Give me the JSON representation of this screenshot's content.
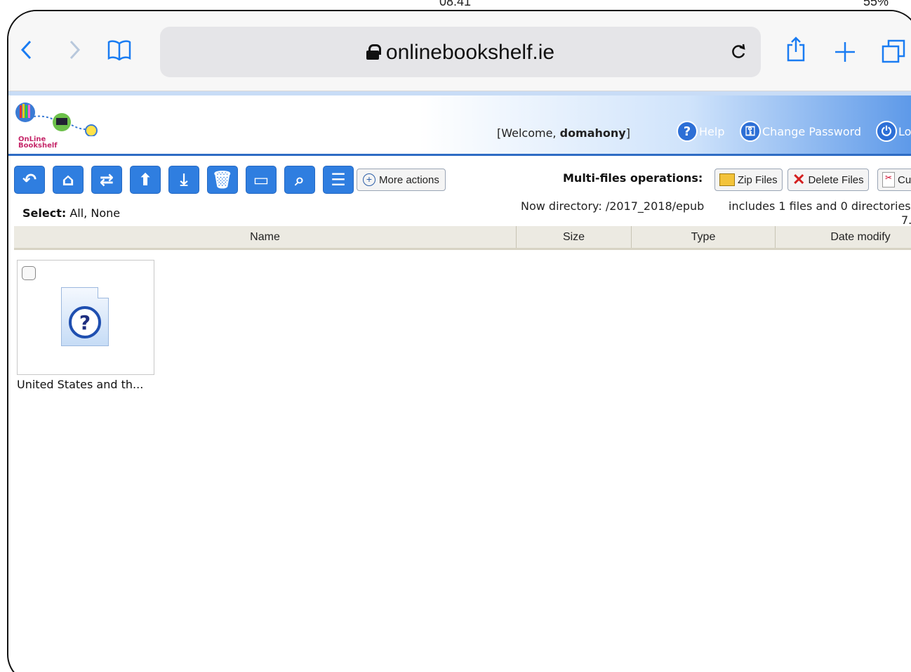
{
  "status": {
    "time": "08:41",
    "battery": "55%"
  },
  "browser": {
    "url": "onlinebookshelf.ie",
    "icons": [
      "back-icon",
      "forward-icon",
      "bookmarks-icon",
      "reload-icon",
      "share-icon",
      "new-tab-icon",
      "tabs-icon"
    ]
  },
  "header": {
    "logo_text_1": "OnLine",
    "logo_text_2": "Bookshelf",
    "welcome_prefix": "[Welcome, ",
    "username": "domahony",
    "welcome_suffix": "]",
    "help": "Help",
    "change_password": "Change Password",
    "logout": "Lo"
  },
  "toolbar": {
    "more_actions": "More actions",
    "multi_label": "Multi-files operations:",
    "zip": "Zip Files",
    "delete": "Delete Files",
    "cut": "Cu"
  },
  "info": {
    "select_label": "Select:",
    "select_options": "All, None",
    "now_directory": "Now directory: /2017_2018/epub",
    "includes": "includes 1 files and 0 directories",
    "size_fragment": "7."
  },
  "table": {
    "columns": [
      "Name",
      "Size",
      "Type",
      "Date modify"
    ]
  },
  "files": [
    {
      "name": "United States and th..."
    }
  ]
}
